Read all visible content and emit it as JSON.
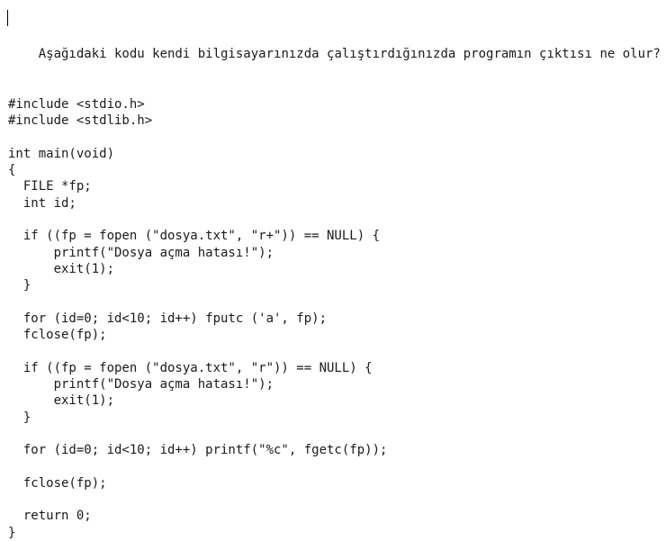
{
  "question": "Aşağıdaki kodu kendi bilgisayarınızda çalıştırdığınızda programın çıktısı ne olur?",
  "code_lines": [
    "#include <stdio.h>",
    "#include <stdlib.h>",
    "",
    "int main(void)",
    "{",
    "  FILE *fp;",
    "  int id;",
    "",
    "  if ((fp = fopen (\"dosya.txt\", \"r+\")) == NULL) {",
    "      printf(\"Dosya açma hatası!\");",
    "      exit(1);",
    "  }",
    "",
    "  for (id=0; id<10; id++) fputc ('a', fp);",
    "  fclose(fp);",
    "",
    "  if ((fp = fopen (\"dosya.txt\", \"r\")) == NULL) {",
    "      printf(\"Dosya açma hatası!\");",
    "      exit(1);",
    "  }",
    "",
    "  for (id=0; id<10; id++) printf(\"%c\", fgetc(fp));",
    "",
    "  fclose(fp);",
    "",
    "  return 0;",
    "}"
  ]
}
